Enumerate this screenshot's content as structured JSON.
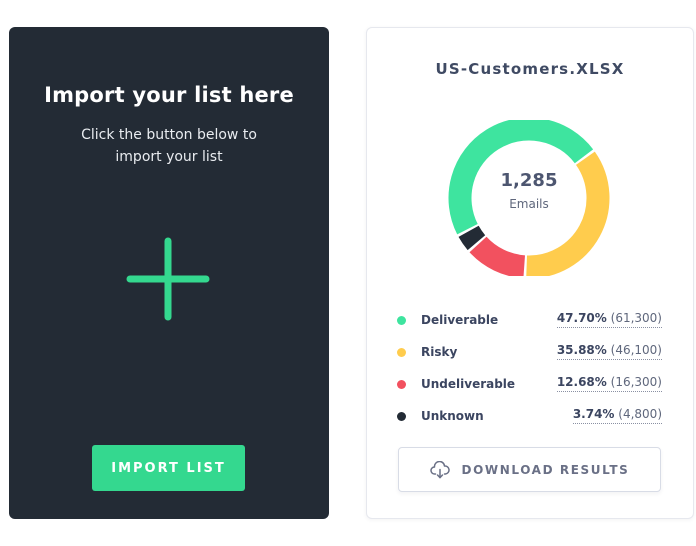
{
  "import_card": {
    "title": "Import your list here",
    "subtitle": "Click the button below to import your list",
    "icon": "plus-icon",
    "button_label": "IMPORT LIST",
    "background_color": "#232b35",
    "accent_color": "#34d88f"
  },
  "results_card": {
    "file_name": "US-Customers.XLSX",
    "total_value": "1,285",
    "total_label": "Emails",
    "download_label": "DOWNLOAD RESULTS",
    "download_icon": "cloud-download-icon"
  },
  "legend": [
    {
      "name": "Deliverable",
      "percent": "47.70%",
      "count": "(61,300)",
      "color": "#3ee49f"
    },
    {
      "name": "Risky",
      "percent": "35.88%",
      "count": "(46,100)",
      "color": "#ffcc4d"
    },
    {
      "name": "Undeliverable",
      "percent": "12.68%",
      "count": "(16,300)",
      "color": "#f2515f"
    },
    {
      "name": "Unknown",
      "percent": "3.74%",
      "count": "(4,800)",
      "color": "#232b35"
    }
  ],
  "chart_data": {
    "type": "pie",
    "categories": [
      "Deliverable",
      "Risky",
      "Undeliverable",
      "Unknown"
    ],
    "values": [
      47.7,
      35.88,
      12.68,
      3.74
    ],
    "counts": [
      61300,
      46100,
      16300,
      4800
    ],
    "colors": [
      "#3ee49f",
      "#ffcc4d",
      "#f2515f",
      "#232b35"
    ],
    "center_value": "1,285",
    "center_label": "Emails",
    "donut": true
  }
}
